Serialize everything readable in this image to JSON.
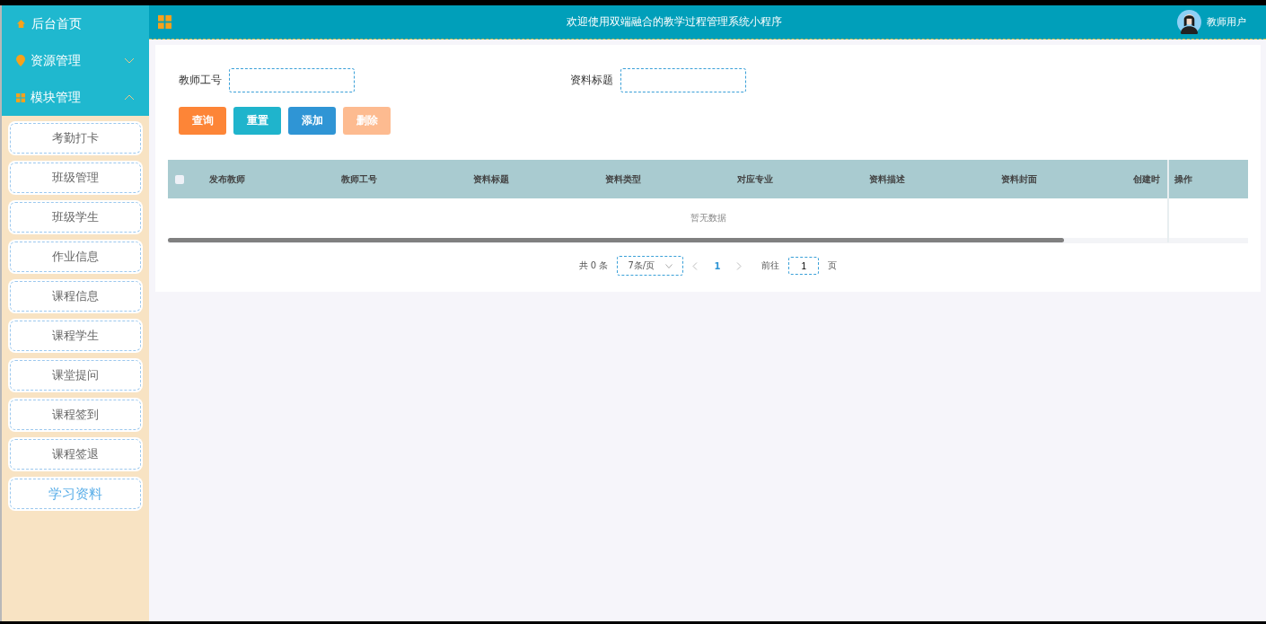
{
  "sidebar": {
    "items": [
      {
        "label": "后台首页",
        "kind": "link"
      },
      {
        "label": "资源管理",
        "kind": "group",
        "expanded": false
      },
      {
        "label": "模块管理",
        "kind": "group",
        "expanded": true,
        "children": [
          {
            "label": "考勤打卡",
            "selected": false
          },
          {
            "label": "班级管理",
            "selected": false
          },
          {
            "label": "班级学生",
            "selected": false
          },
          {
            "label": "作业信息",
            "selected": false
          },
          {
            "label": "课程信息",
            "selected": false
          },
          {
            "label": "课程学生",
            "selected": false
          },
          {
            "label": "课堂提问",
            "selected": false
          },
          {
            "label": "课程签到",
            "selected": false
          },
          {
            "label": "课程签退",
            "selected": false
          },
          {
            "label": "学习资料",
            "selected": true
          }
        ]
      }
    ]
  },
  "header": {
    "title": "欢迎使用双端融合的教学过程管理系统小程序",
    "user": "教师用户"
  },
  "search": {
    "fields": [
      {
        "label": "教师工号"
      },
      {
        "label": "资料标题"
      }
    ],
    "buttons": [
      {
        "label": "查询",
        "kind": "search",
        "disabled": false
      },
      {
        "label": "重置",
        "kind": "reset",
        "disabled": false
      },
      {
        "label": "添加",
        "kind": "add",
        "disabled": false
      },
      {
        "label": "删除",
        "kind": "delete",
        "disabled": true
      }
    ]
  },
  "table": {
    "select_all": {
      "checked": false
    },
    "columns": [
      "发布教师",
      "教师工号",
      "资料标题",
      "资料类型",
      "对应专业",
      "资料描述",
      "资料封面",
      "创建时"
    ],
    "fixed_column": "操作",
    "empty_text": "暂无数据"
  },
  "pagination": {
    "total": "共 0 条",
    "page_size": "7条/页",
    "pages": [
      {
        "label": "1",
        "selected": true
      }
    ],
    "goto_label": "前往",
    "goto_value": "1",
    "goto_unit": "页"
  }
}
